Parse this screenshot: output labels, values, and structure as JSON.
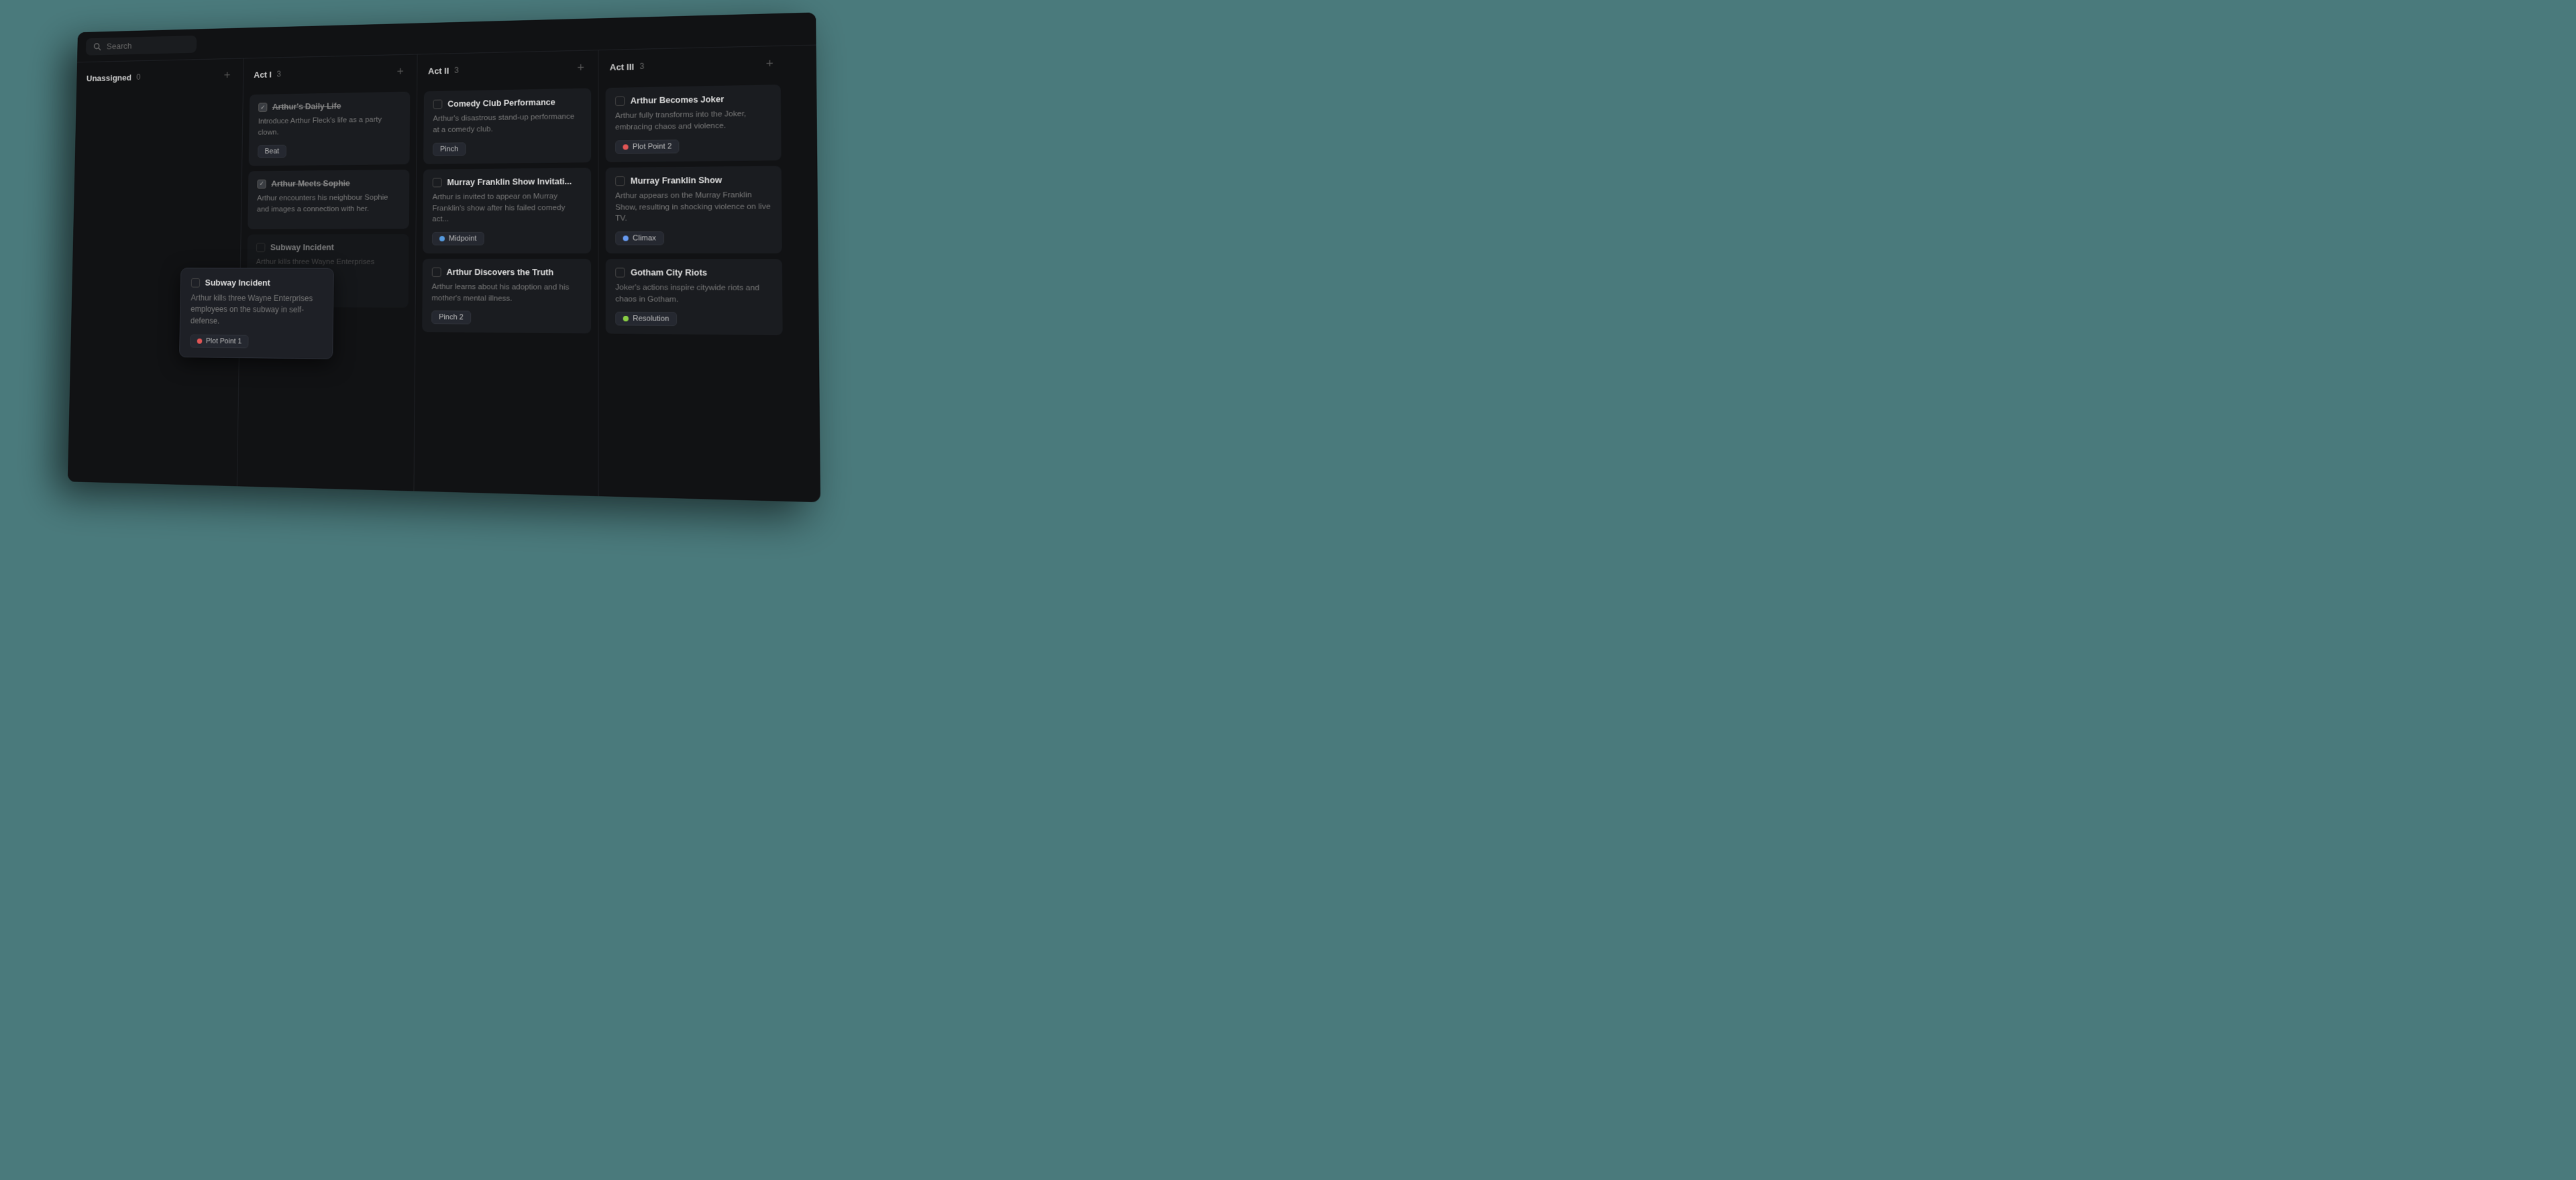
{
  "search": {
    "placeholder": "Search"
  },
  "colors": {
    "background": "#4a7a7c",
    "app_bg": "#111214",
    "card_bg": "#1a1c20"
  },
  "columns": [
    {
      "id": "unassigned",
      "title": "Unassigned",
      "count": 0,
      "cards": []
    },
    {
      "id": "act1",
      "title": "Act I",
      "count": 3,
      "cards": [
        {
          "id": "arthurs-daily-life",
          "title": "Arthur's Daily Life",
          "title_strikethrough": true,
          "checked": true,
          "description": "Introduce Arthur Fleck's life as a party clown.",
          "tag": {
            "label": "Beat",
            "color": null,
            "dot": null
          }
        },
        {
          "id": "arthur-meets-sophie",
          "title": "Arthur Meets Sophie",
          "title_strikethrough": true,
          "checked": true,
          "description": "Arthur encounters his neighbour Sophie and images a connection with her.",
          "tag": null
        },
        {
          "id": "subway-incident",
          "title": "Subway Incident",
          "title_strikethrough": false,
          "checked": false,
          "description": "Arthur kills three Wayne Enterprises employees...",
          "tag": {
            "label": "Plot Point 1",
            "color": "#e05555",
            "dot": true
          }
        }
      ]
    },
    {
      "id": "act2",
      "title": "Act II",
      "count": 3,
      "cards": [
        {
          "id": "comedy-club",
          "title": "Comedy Club Performance",
          "title_strikethrough": false,
          "checked": false,
          "description": "Arthur's disastrous stand-up performance at a comedy club.",
          "tag": {
            "label": "Pinch",
            "color": null,
            "dot": null
          }
        },
        {
          "id": "murray-invitation",
          "title": "Murray Franklin Show Invitati...",
          "title_strikethrough": false,
          "checked": false,
          "description": "Arthur is invited to appear on Murray Franklin's show after his failed comedy act...",
          "tag": {
            "label": "Midpoint",
            "color": "#5599dd",
            "dot": true
          }
        },
        {
          "id": "arthur-discovers",
          "title": "Arthur Discovers the Truth",
          "title_strikethrough": false,
          "checked": false,
          "description": "Arthur learns about his adoption and his mother's mental illness.",
          "tag": {
            "label": "Pinch 2",
            "color": null,
            "dot": null
          }
        }
      ]
    },
    {
      "id": "act3",
      "title": "Act III",
      "count": 3,
      "cards": [
        {
          "id": "arthur-becomes-joker",
          "title": "Arthur Becomes Joker",
          "title_strikethrough": false,
          "checked": false,
          "description": "Arthur fully transforms into the Joker, embracing chaos and violence.",
          "tag": {
            "label": "Plot Point 2",
            "color": "#e05555",
            "dot": true
          }
        },
        {
          "id": "murray-show",
          "title": "Murray Franklin Show",
          "title_strikethrough": false,
          "checked": false,
          "description": "Arthur appears on the Murray Franklin Show, resulting in shocking violence on live TV.",
          "tag": {
            "label": "Climax",
            "color": "#6699ee",
            "dot": true
          }
        },
        {
          "id": "gotham-riots",
          "title": "Gotham City Riots",
          "title_strikethrough": false,
          "checked": false,
          "description": "Joker's actions inspire citywide riots and chaos in Gotham.",
          "tag": {
            "label": "Resolution",
            "color": "#88cc44",
            "dot": true
          }
        }
      ]
    }
  ],
  "tooltip": {
    "title": "Subway Incident",
    "description": "Arthur kills three Wayne Enterprises employees on the subway in self-defense.",
    "tag": {
      "label": "Plot Point 1",
      "color": "#e05555",
      "dot": true
    }
  }
}
